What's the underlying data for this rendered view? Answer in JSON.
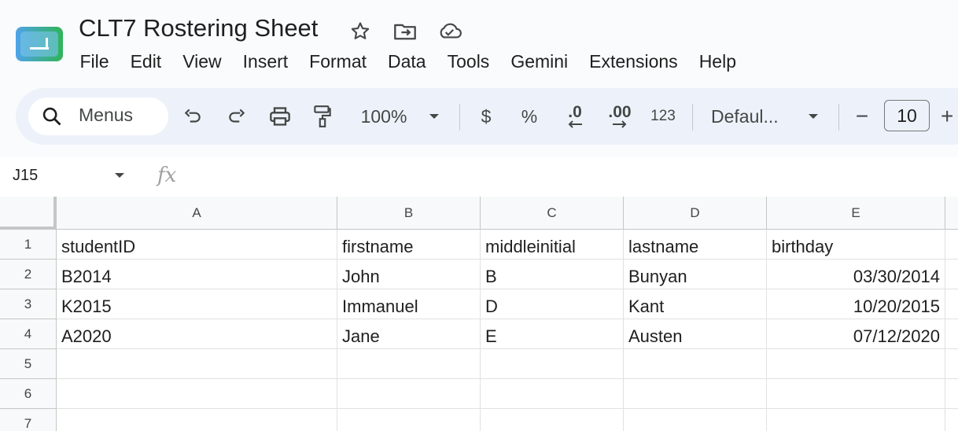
{
  "app": {
    "title": "CLT7 Rostering Sheet",
    "icons": [
      "sheets-logo-icon",
      "star-icon",
      "move-to-folder-icon",
      "cloud-saved-icon"
    ]
  },
  "menu": [
    "File",
    "Edit",
    "View",
    "Insert",
    "Format",
    "Data",
    "Tools",
    "Gemini",
    "Extensions",
    "Help"
  ],
  "toolbar": {
    "search_placeholder": "Menus",
    "zoom": "100%",
    "currency": "$",
    "percent": "%",
    "decrease_decimal": ".0",
    "increase_decimal": ".00",
    "number_format": "123",
    "font": "Defaul...",
    "minus": "−",
    "font_size": "10",
    "plus": "+"
  },
  "formula_bar": {
    "name_box": "J15",
    "fx": "fx",
    "value": ""
  },
  "sheet": {
    "columns": [
      "A",
      "B",
      "C",
      "D",
      "E"
    ],
    "row_numbers": [
      "1",
      "2",
      "3",
      "4",
      "5",
      "6",
      "7"
    ],
    "rows": [
      [
        "studentID",
        "firstname",
        "middleinitial",
        "lastname",
        "birthday"
      ],
      [
        "B2014",
        "John",
        "B",
        "Bunyan",
        "03/30/2014"
      ],
      [
        "K2015",
        "Immanuel",
        "D",
        "Kant",
        "10/20/2015"
      ],
      [
        "A2020",
        "Jane",
        "E",
        "Austen",
        "07/12/2020"
      ],
      [
        "",
        "",
        "",
        "",
        ""
      ],
      [
        "",
        "",
        "",
        "",
        ""
      ],
      [
        "",
        "",
        "",
        "",
        ""
      ]
    ]
  },
  "colors": {
    "accent_green": "#34a853",
    "accent_blue": "#4285f4",
    "toolbar_bg": "#edf2fa"
  }
}
